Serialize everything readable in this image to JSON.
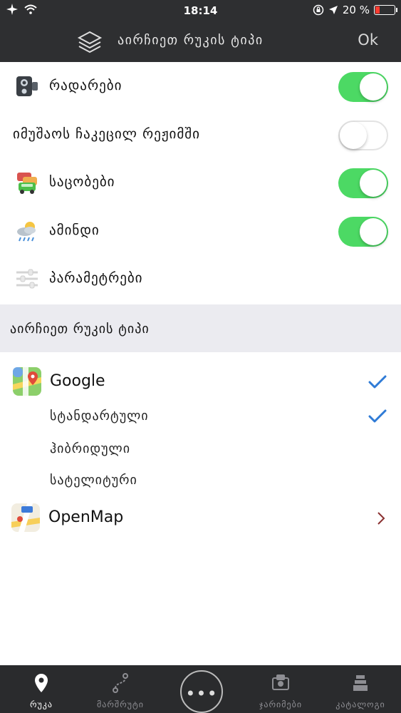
{
  "status_bar": {
    "time": "18:14",
    "battery_percent": "20 %",
    "battery_level": 0.2
  },
  "nav": {
    "title": "აირჩიეთ რუკის ტიპი",
    "ok_label": "Ok",
    "icon": "layers-icon"
  },
  "settings": [
    {
      "label": "რადარები",
      "icon": "speed-camera-icon",
      "toggle": true
    },
    {
      "label": "იმუშაოს ჩაკეცილ რეჟიმში",
      "toggle": false
    },
    {
      "label": "საცობები",
      "icon": "traffic-cars-icon",
      "toggle": true
    },
    {
      "label": "ამინდი",
      "icon": "weather-icon",
      "toggle": true
    },
    {
      "label": "პარამეტრები",
      "icon": "sliders-icon"
    }
  ],
  "map_section": {
    "title": "აირჩიეთ რუკის ტიპი",
    "providers": [
      {
        "name": "Google",
        "icon": "google-maps-icon",
        "selected": true,
        "types": [
          {
            "label": "სტანდარტული",
            "selected": true
          },
          {
            "label": "ჰიბრიდული",
            "selected": false
          },
          {
            "label": "სატელიტური",
            "selected": false
          }
        ]
      },
      {
        "name": "OpenMap",
        "icon": "apple-maps-icon"
      }
    ]
  },
  "tabs": [
    {
      "label": "რუკა",
      "icon": "map-pin-icon",
      "active": true
    },
    {
      "label": "მარშრუტი",
      "icon": "route-icon",
      "active": false
    },
    {
      "label": "",
      "icon": "more-dots-icon",
      "active": false
    },
    {
      "label": "ჯარიმები",
      "icon": "fines-icon",
      "active": false
    },
    {
      "label": "კატალოგი",
      "icon": "catalog-icon",
      "active": false
    }
  ],
  "colors": {
    "toggle_on": "#4cd964",
    "check": "#2f7bd6",
    "header_bg": "#2e2f31",
    "section_bg": "#ebebf0"
  }
}
